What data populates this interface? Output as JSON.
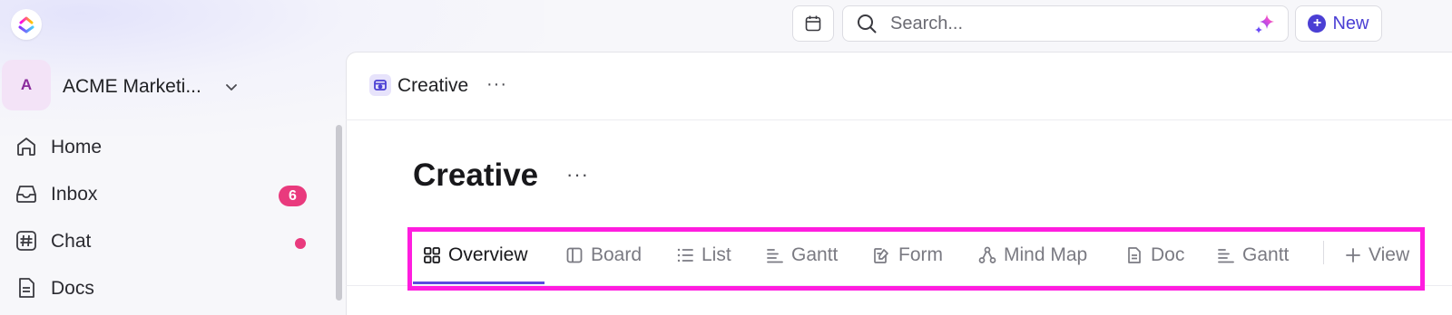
{
  "topbar": {
    "search_placeholder": "Search...",
    "new_label": "New"
  },
  "workspace": {
    "avatar_letter": "A",
    "name": "ACME Marketi..."
  },
  "sidebar": {
    "items": [
      {
        "label": "Home",
        "icon": "home-icon"
      },
      {
        "label": "Inbox",
        "icon": "inbox-icon",
        "badge": "6"
      },
      {
        "label": "Chat",
        "icon": "hash-icon",
        "unread_dot": true
      },
      {
        "label": "Docs",
        "icon": "doc-icon"
      }
    ]
  },
  "breadcrumb": {
    "label": "Creative",
    "more": "···"
  },
  "page": {
    "title": "Creative",
    "more": "···"
  },
  "tabs": [
    {
      "label": "Overview",
      "icon": "overview-grid-icon",
      "active": true
    },
    {
      "label": "Board",
      "icon": "board-icon"
    },
    {
      "label": "List",
      "icon": "list-icon"
    },
    {
      "label": "Gantt",
      "icon": "gantt-icon"
    },
    {
      "label": "Form",
      "icon": "form-icon"
    },
    {
      "label": "Mind Map",
      "icon": "mind-map-icon"
    },
    {
      "label": "Doc",
      "icon": "doc-icon"
    },
    {
      "label": "Gantt",
      "icon": "gantt-icon"
    }
  ],
  "add_view_label": "View",
  "colors": {
    "accent": "#4b3fd4",
    "badge": "#e93a7d",
    "highlight": "#ff1ddf"
  }
}
